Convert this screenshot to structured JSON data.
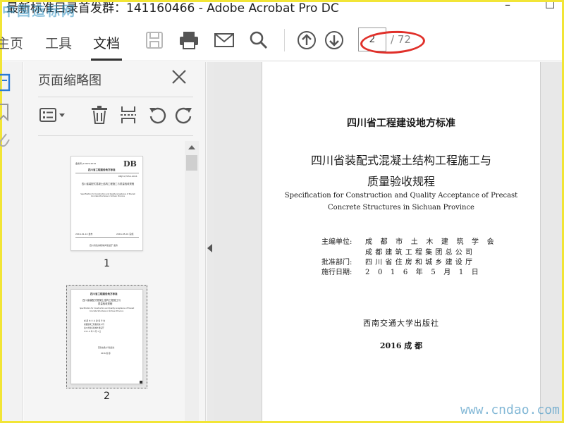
{
  "window": {
    "title": "最新标准目录首发群：141160466 - Adobe Acrobat Pro DC",
    "watermark_top": "中国造标网",
    "controls": {
      "minimize": "–",
      "maximize": "☐"
    }
  },
  "toolbar": {
    "tabs": [
      {
        "label": "主页"
      },
      {
        "label": "工具"
      },
      {
        "label": "文档",
        "active": true
      }
    ],
    "icons": [
      "save-icon",
      "print-icon",
      "email-icon",
      "search-icon",
      "page-up-icon",
      "page-down-icon"
    ],
    "page_current": "2",
    "page_total": "/ 72"
  },
  "thumbnail_panel": {
    "title": "页面缩略图",
    "tools": [
      "options-menu-icon",
      "delete-icon",
      "extract-icon",
      "rotate-left-icon",
      "rotate-right-icon"
    ],
    "pages": [
      {
        "number": "1",
        "header_left": "备案号 J13229-2016",
        "logo": "DB",
        "standard_no": "DBJ51/T054-2016",
        "org": "四川省工程建设地方标准",
        "title_cn": "四川省装配式混凝土结构工程施工与质量验收规程",
        "title_en": "Specification for Construction and Quality Acceptance of Precast Concrete Structures in Sichuan Province",
        "issue_date": "2016-01-12 发布",
        "impl_date": "2016-05-01 实施",
        "issuer": "四川省住房和城乡建设厅 发布"
      },
      {
        "number": "2",
        "selected": true
      }
    ]
  },
  "document": {
    "standard_type": "四川省工程建设地方标准",
    "title_line1": "四川省装配式混凝土结构工程施工与",
    "title_line2": "质量验收规程",
    "title_en_line1": "Specification for Construction and Quality Acceptance of Precast",
    "title_en_line2": "Concrete Structures in Sichuan Province",
    "info": [
      {
        "label": "主编单位:",
        "value": "成 都 市 土 木 建 筑 学 会"
      },
      {
        "label": "",
        "value": "成都建筑工程集团总公司"
      },
      {
        "label": "批准部门:",
        "value": "四川省住房和城乡建设厅"
      },
      {
        "label": "施行日期:",
        "value": "2 0 1 6  年  5  月  1  日"
      }
    ],
    "publisher": "西南交通大学出版社",
    "year_place": "2016  成  都"
  },
  "watermark_bottom": "www.cndao.com",
  "colors": {
    "frame": "#f2e536",
    "annotation": "#e0302a"
  }
}
